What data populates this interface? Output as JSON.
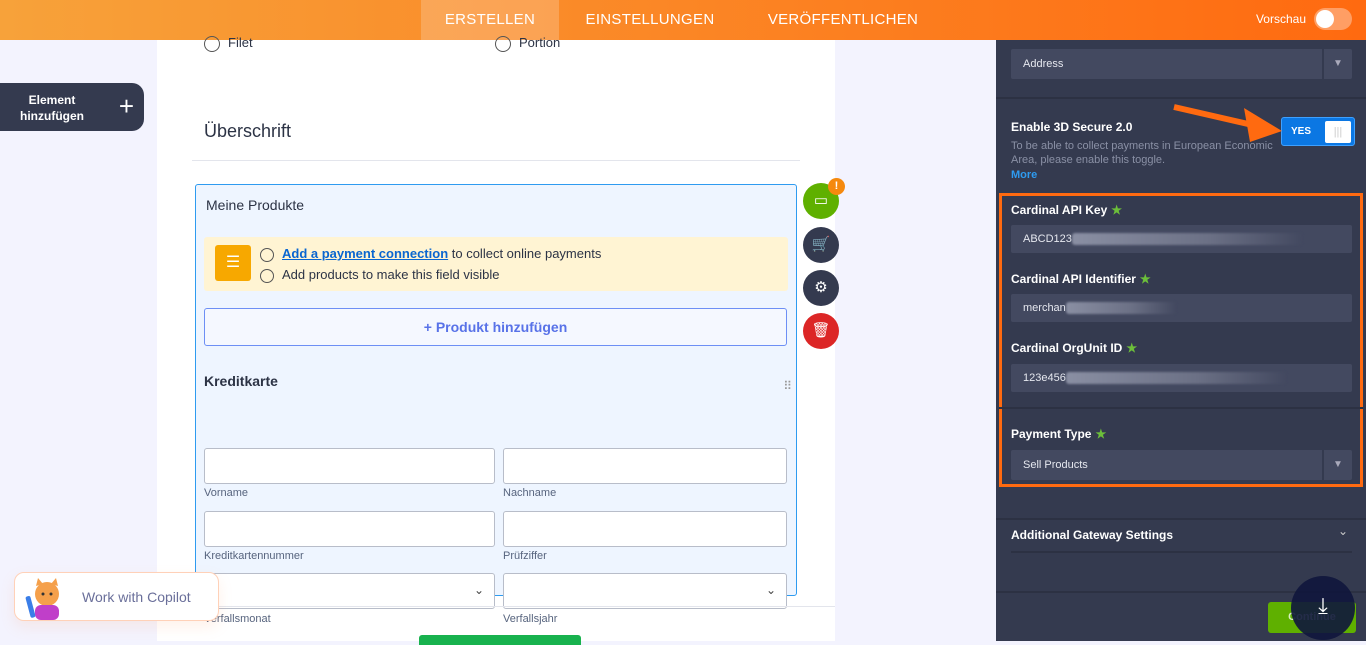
{
  "topbar": {
    "tabs": [
      {
        "label": "ERSTELLEN",
        "active": true
      },
      {
        "label": "EINSTELLUNGEN"
      },
      {
        "label": "VERÖFFENTLICHEN"
      }
    ],
    "preview_label": "Vorschau"
  },
  "sidebar": {
    "add_element": "Element hinzufügen"
  },
  "form": {
    "options": [
      "Filet",
      "Portion"
    ],
    "heading": "Überschrift",
    "products": {
      "title": "Meine Produkte",
      "notice_link": "Add a payment connection",
      "notice_rest": " to collect online payments",
      "notice_line2": "Add products to make this field visible",
      "add_product": "+ Produkt hinzufügen"
    },
    "credit_card": {
      "title": "Kreditkarte",
      "fields": [
        "Vorname",
        "Nachname",
        "Kreditkartennummer",
        "Prüfziffer",
        "Verfallsmonat",
        "Verfallsjahr"
      ]
    }
  },
  "copilot": {
    "label": "Work with Copilot"
  },
  "panel": {
    "address_select": "Address",
    "secure_label": "Enable 3D Secure 2.0",
    "secure_desc": "To be able to collect payments in European Economic Area, please enable this toggle.",
    "more": "More",
    "secure_toggle": "YES",
    "api_key_label": "Cardinal API Key",
    "api_key_value": "ABCD123",
    "api_id_label": "Cardinal API Identifier",
    "api_id_value": "merchan",
    "orgunit_label": "Cardinal OrgUnit ID",
    "orgunit_value": "123e456",
    "payment_type_label": "Payment Type",
    "payment_type_value": "Sell Products",
    "additional": "Additional Gateway Settings",
    "continue": "Continue"
  },
  "colors": {
    "accent": "#ff6a10",
    "panel": "#343a4f",
    "link": "#0a66d0",
    "success": "#5fb000"
  }
}
